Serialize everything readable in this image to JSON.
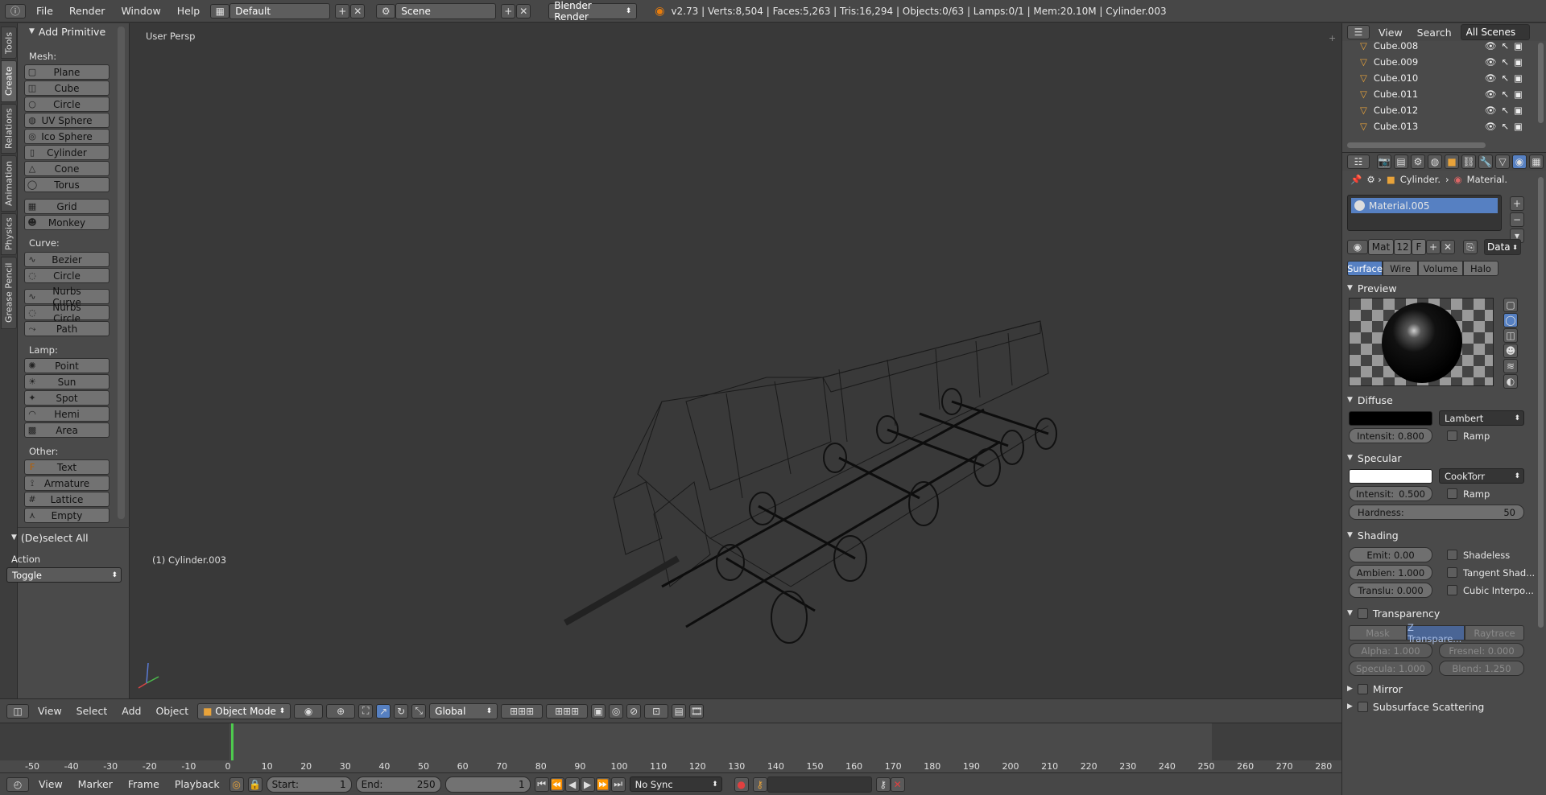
{
  "topbar": {
    "menus": [
      "File",
      "Render",
      "Window",
      "Help"
    ],
    "layout": "Default",
    "scene": "Scene",
    "engine": "Blender Render",
    "stats": "v2.73 | Verts:8,504 | Faces:5,263 | Tris:16,294 | Objects:0/63 | Lamps:0/1 | Mem:20.10M | Cylinder.003"
  },
  "tabs": [
    "Tools",
    "Create",
    "Relations",
    "Animation",
    "Physics",
    "Grease Pencil"
  ],
  "toolshelf": {
    "title": "Add Primitive",
    "mesh_label": "Mesh:",
    "mesh": [
      "Plane",
      "Cube",
      "Circle",
      "UV Sphere",
      "Ico Sphere",
      "Cylinder",
      "Cone",
      "Torus"
    ],
    "mesh2": [
      "Grid",
      "Monkey"
    ],
    "curve_label": "Curve:",
    "curve": [
      "Bezier",
      "Circle"
    ],
    "curve2": [
      "Nurbs Curve",
      "Nurbs Circle",
      "Path"
    ],
    "lamp_label": "Lamp:",
    "lamp": [
      "Point",
      "Sun",
      "Spot",
      "Hemi",
      "Area"
    ],
    "other_label": "Other:",
    "other": [
      "Text",
      "Armature",
      "Lattice",
      "Empty"
    ],
    "deselect_title": "(De)select All",
    "action_label": "Action",
    "action_value": "Toggle"
  },
  "viewport": {
    "label": "User Persp",
    "object_label": "(1) Cylinder.003"
  },
  "view_header": {
    "menus": [
      "View",
      "Select",
      "Add",
      "Object"
    ],
    "mode": "Object Mode",
    "orientation": "Global"
  },
  "timeline": {
    "ticks": [
      "-50",
      "-40",
      "-30",
      "-20",
      "-10",
      "0",
      "10",
      "20",
      "30",
      "40",
      "50",
      "60",
      "70",
      "80",
      "90",
      "100",
      "110",
      "120",
      "130",
      "140",
      "150",
      "160",
      "170",
      "180",
      "190",
      "200",
      "210",
      "220",
      "230",
      "240",
      "250",
      "260",
      "270",
      "280"
    ],
    "menus": [
      "View",
      "Marker",
      "Frame",
      "Playback"
    ],
    "start_label": "Start:",
    "start_value": "1",
    "end_label": "End:",
    "end_value": "250",
    "current": "1",
    "sync": "No Sync"
  },
  "outliner": {
    "menus": [
      "View",
      "Search"
    ],
    "scene_filter": "All Scenes",
    "items": [
      "Cube.008",
      "Cube.009",
      "Cube.010",
      "Cube.011",
      "Cube.012",
      "Cube.013"
    ]
  },
  "properties": {
    "breadcrumb_object": "Cylinder.",
    "breadcrumb_material": "Material.",
    "material_slot": "Material.005",
    "mat_field": "Mat",
    "users": "12",
    "fake": "F",
    "link": "Data",
    "tabs": [
      "Surface",
      "Wire",
      "Volume",
      "Halo"
    ],
    "preview_title": "Preview",
    "diffuse_title": "Diffuse",
    "diffuse_shader": "Lambert",
    "diffuse_intensity": "Intensit: 0.800",
    "ramp": "Ramp",
    "specular_title": "Specular",
    "specular_shader": "CookTorr",
    "specular_intensity_label": "Intensit:",
    "specular_intensity_value": "0.500",
    "hardness_label": "Hardness:",
    "hardness_value": "50",
    "shading_title": "Shading",
    "emit": "Emit:      0.00",
    "ambient": "Ambien: 1.000",
    "translucency": "Translu: 0.000",
    "shadeless": "Shadeless",
    "tangent": "Tangent Shad...",
    "cubic": "Cubic Interpo...",
    "transparency_title": "Transparency",
    "trans_tabs": [
      "Mask",
      "Z Transpare...",
      "Raytrace"
    ],
    "alpha": "Alpha:   1.000",
    "fresnel": "Fresnel: 0.000",
    "specular_alpha": "Specula: 1.000",
    "blend": "Blend:     1.250",
    "mirror_title": "Mirror",
    "sss_title": "Subsurface Scattering"
  },
  "colors": {
    "accent": "#5680c2",
    "diffuse_color": "#000000",
    "specular_color": "#ffffff",
    "playhead": "#4ec94e"
  }
}
